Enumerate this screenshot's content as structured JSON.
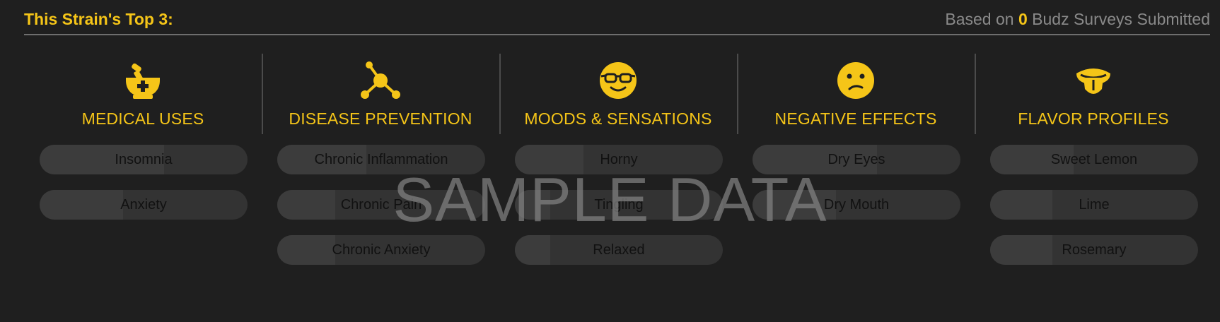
{
  "header": {
    "title": "This Strain's Top 3:",
    "based_on": "Based on",
    "count": "0",
    "suffix": "Budz Surveys Submitted"
  },
  "watermark": "SAMPLE DATA",
  "colors": {
    "accent": "#f5c518",
    "background": "#1f1f1f",
    "bar_track": "#333333",
    "bar_fill": "#3c3c3c"
  },
  "columns": [
    {
      "icon": "mortar-pestle-icon",
      "label": "MEDICAL USES",
      "items": [
        {
          "label": "Insomnia",
          "level": 0.6
        },
        {
          "label": "Anxiety",
          "level": 0.4
        }
      ]
    },
    {
      "icon": "molecule-icon",
      "label": "DISEASE PREVENTION",
      "items": [
        {
          "label": "Chronic Inflammation",
          "level": 0.43
        },
        {
          "label": "Chronic Pain",
          "level": 0.28
        },
        {
          "label": "Chronic Anxiety",
          "level": 0.28
        }
      ]
    },
    {
      "icon": "cool-face-icon",
      "label": "MOODS & SENSATIONS",
      "items": [
        {
          "label": "Horny",
          "level": 0.33
        },
        {
          "label": "Tingling",
          "level": 0.17
        },
        {
          "label": "Relaxed",
          "level": 0.17
        }
      ]
    },
    {
      "icon": "sad-face-icon",
      "label": "NEGATIVE EFFECTS",
      "items": [
        {
          "label": "Dry Eyes",
          "level": 0.6
        },
        {
          "label": "Dry Mouth",
          "level": 0.4
        }
      ]
    },
    {
      "icon": "tongue-face-icon",
      "label": "FLAVOR PROFILES",
      "items": [
        {
          "label": "Sweet Lemon",
          "level": 0.4
        },
        {
          "label": "Lime",
          "level": 0.3
        },
        {
          "label": "Rosemary",
          "level": 0.3
        }
      ]
    }
  ]
}
